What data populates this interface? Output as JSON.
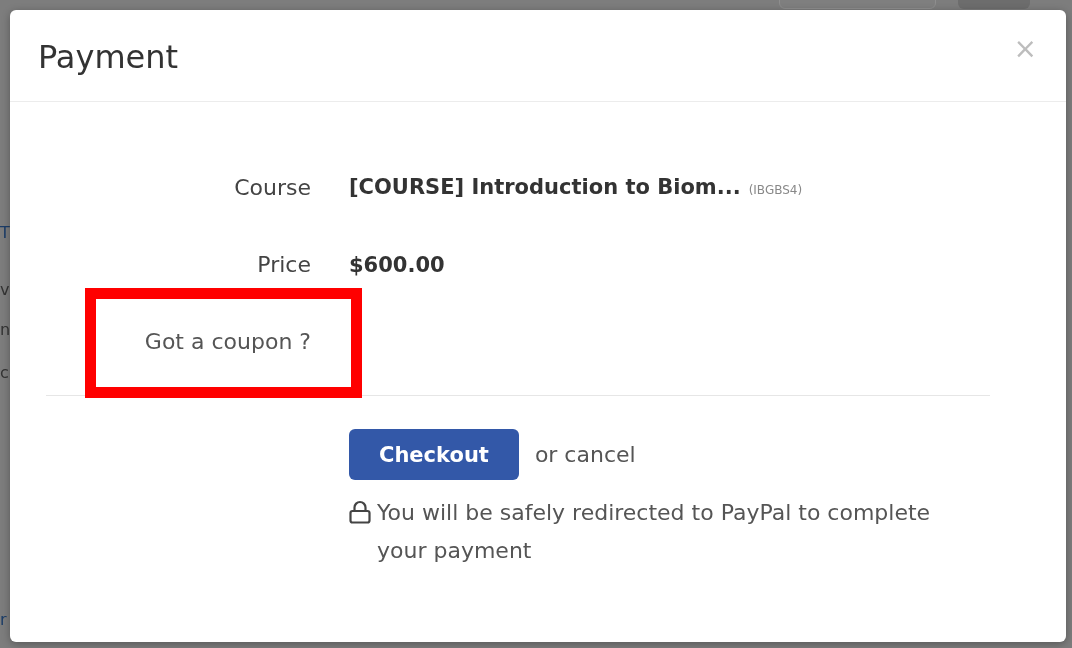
{
  "backdrop": {
    "fragments": [
      {
        "text": "T",
        "kind": "link"
      },
      {
        "text": "v",
        "kind": "text"
      },
      {
        "text": "n",
        "kind": "text"
      },
      {
        "text": "c",
        "kind": "text"
      },
      {
        "text": "r",
        "kind": "link"
      }
    ]
  },
  "dialog": {
    "title": "Payment",
    "close": "×",
    "fields": [
      {
        "label": "Course",
        "kind": "course",
        "value": "[COURSE] Introduction to Biom...",
        "code": "(IBGBS4)"
      },
      {
        "label": "Price",
        "kind": "price",
        "value": "$600.00"
      }
    ],
    "coupon": {
      "label": "Got a coupon ?",
      "highlighted": true
    },
    "checkout_button": "Checkout",
    "cancel_link": "or cancel",
    "note": "You will be safely redirected to PayPal to complete your payment"
  }
}
